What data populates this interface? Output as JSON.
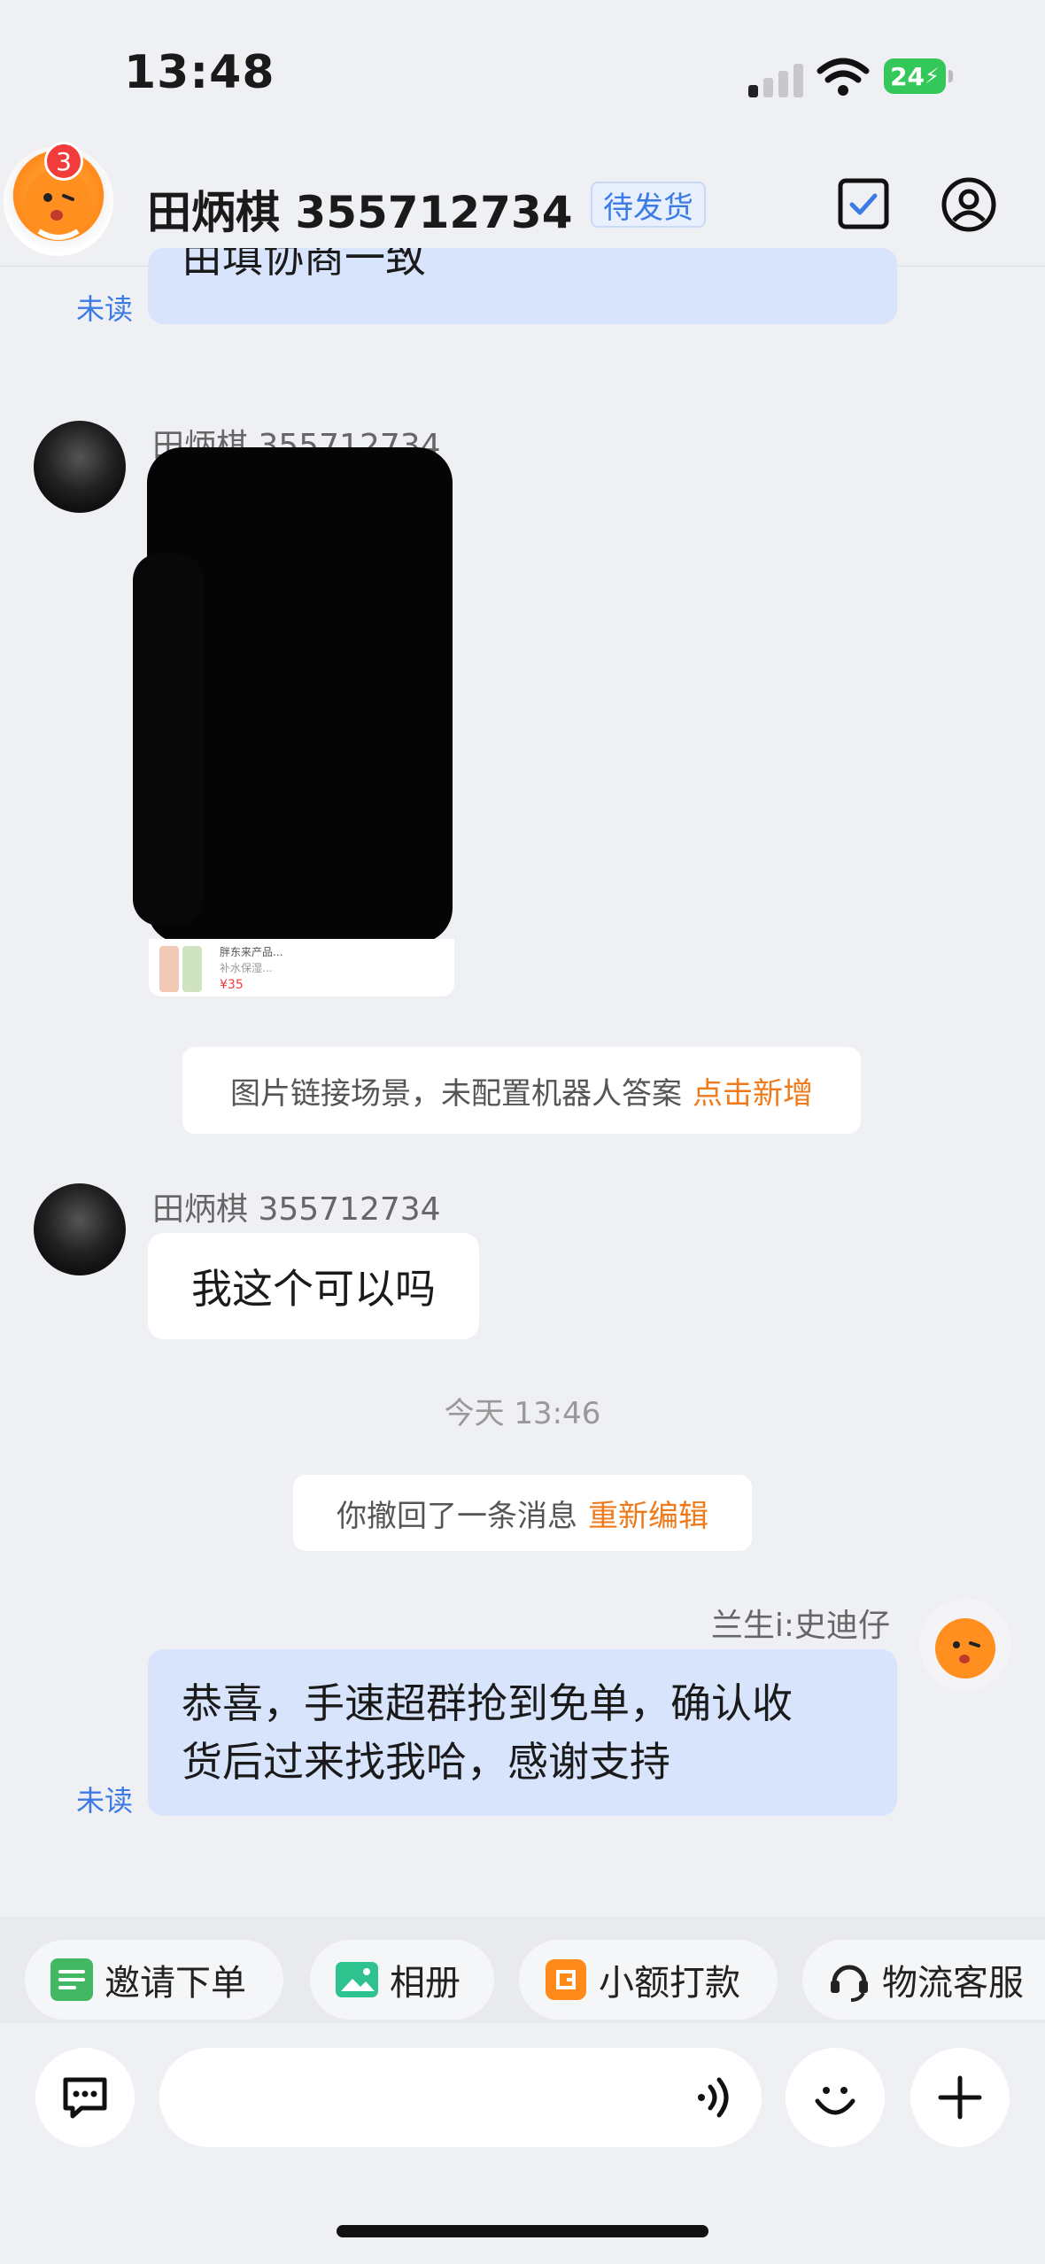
{
  "status_bar": {
    "time": "13:48",
    "battery": "24"
  },
  "header": {
    "unread_count": "3",
    "title": "田炳棋 355712734",
    "order_status": "待发货"
  },
  "messages": {
    "partial_text": "由填协商一致",
    "unread_label": "未读",
    "image_sender": "田炳棋 355712734",
    "image_caption_line1": "胖东来产品...",
    "image_caption_line2": "补水保湿...",
    "image_price": "¥35",
    "system_notice": "图片链接场景，未配置机器人答案",
    "system_notice_action": "点击新增",
    "text_sender": "田炳棋 355712734",
    "text_message": "我这个可以吗",
    "timestamp": "今天 13:46",
    "recall_notice": "你撤回了一条消息",
    "recall_action": "重新编辑",
    "agent_name": "兰生i:史迪仔",
    "agent_message_line1": "恭喜，手速超群抢到免单，确认收",
    "agent_message_line2": "货后过来找我哈，感谢支持",
    "agent_unread_label": "未读"
  },
  "quick_actions": [
    {
      "label": "邀请下单",
      "icon": "invite-order-icon",
      "color": "#43B864"
    },
    {
      "label": "相册",
      "icon": "album-icon",
      "color": "#2EC28E"
    },
    {
      "label": "小额打款",
      "icon": "small-payment-icon",
      "color": "#FF8A1A"
    },
    {
      "label": "物流客服",
      "icon": "logistics-service-icon",
      "color": "#222222"
    }
  ],
  "input": {
    "placeholder": ""
  },
  "colors": {
    "accent_blue": "#3C7BE6",
    "accent_orange": "#F07A1A",
    "bubble_blue": "#D8E4FB"
  }
}
